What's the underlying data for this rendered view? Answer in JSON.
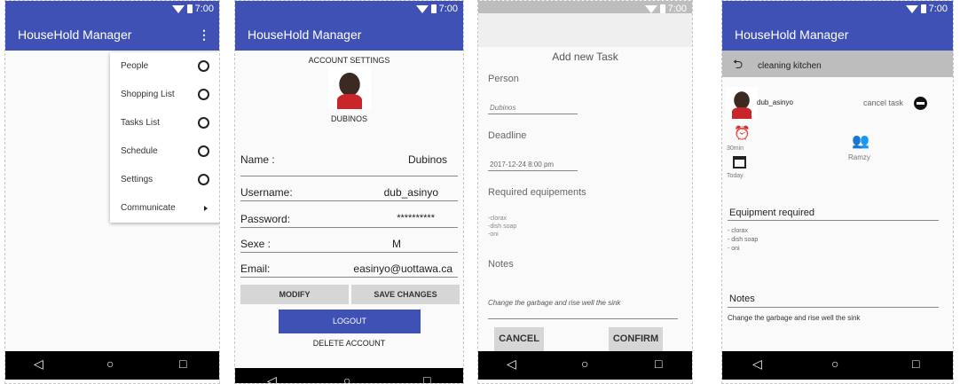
{
  "status": {
    "time": "7:00"
  },
  "nav": {
    "back": "◁",
    "home": "○",
    "recent": "□"
  },
  "screen1": {
    "app_title": "HouseHold Manager",
    "menu": [
      {
        "label": "People"
      },
      {
        "label": "Shopping List"
      },
      {
        "label": "Tasks List"
      },
      {
        "label": "Schedule"
      },
      {
        "label": "Settings"
      },
      {
        "label": "Communicate"
      }
    ]
  },
  "screen2": {
    "app_title": "HouseHold Manager",
    "section_title": "ACCOUNT SETTINGS",
    "display_name": "DUBINOS",
    "fields": [
      {
        "label": "Name :",
        "value": "Dubinos"
      },
      {
        "label": "Username:",
        "value": "dub_asinyo"
      },
      {
        "label": "Password:",
        "value": "**********"
      },
      {
        "label": "Sexe :",
        "value": "M"
      },
      {
        "label": "Email:",
        "value": "easinyo@uottawa.ca"
      }
    ],
    "modify": "MODIFY",
    "save": "SAVE CHANGES",
    "logout": "LOGOUT",
    "delete": "DELETE ACCOUNT"
  },
  "screen3": {
    "title": "Add new Task",
    "person_label": "Person",
    "person_value": "Dubinos",
    "deadline_label": "Deadline",
    "deadline_value": "2017-12-24 8:00 pm",
    "equip_label": "Required equipements",
    "equip_lines": [
      "-clorax",
      "-dish soap",
      "-oni"
    ],
    "notes_label": "Notes",
    "notes_value": "Change the garbage and rise well the sink",
    "cancel": "CANCEL",
    "confirm": "CONFIRM"
  },
  "screen4": {
    "app_title": "HouseHold Manager",
    "task_title": "cleaning kitchen",
    "username": "dub_asinyo",
    "cancel_task": "cancel task",
    "duration": "30min",
    "date": "Today",
    "assignee": "Ramzy",
    "equip_label": "Equipment required",
    "equip_lines": [
      "- clorax",
      "- dish soap",
      "- oni"
    ],
    "notes_label": "Notes",
    "notes_value": "Change the garbage and rise well the sink"
  }
}
